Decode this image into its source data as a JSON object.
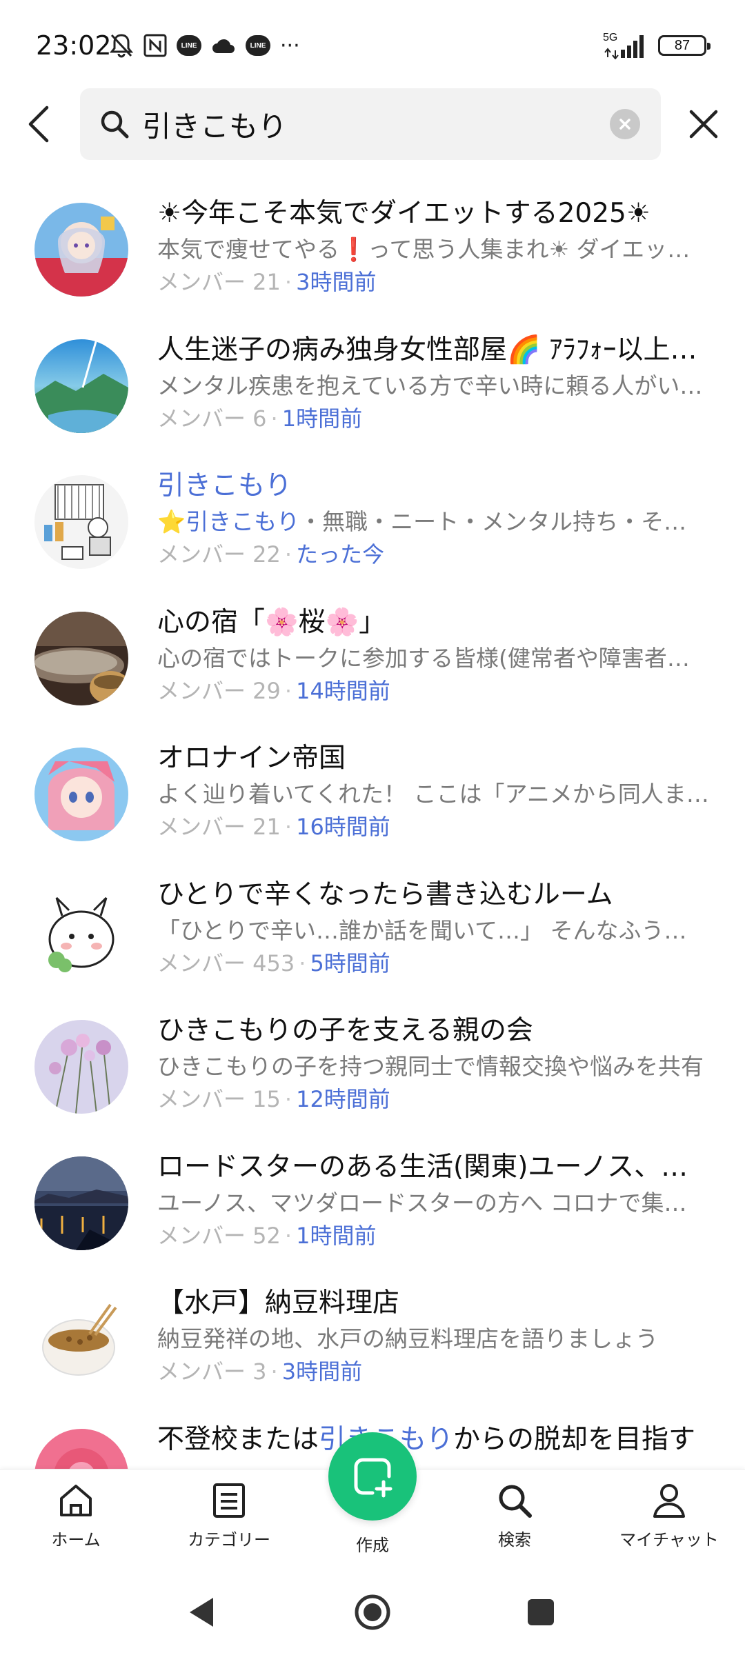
{
  "status_bar": {
    "time": "23:02",
    "network": "5G",
    "battery": "87",
    "line_badge": "LINE",
    "more": "···"
  },
  "search": {
    "query": "引きこもり"
  },
  "results": [
    {
      "title": "☀今年こそ本気でダイエットする2025☀",
      "desc": "本気で痩せてやる❗って思う人集まれ☀ ダイエット仲間募集中",
      "members": "メンバー 21",
      "time": "3時間前"
    },
    {
      "title": "人生迷子の病み独身女性部屋🌈 ｱﾗﾌｫｰ以上の方",
      "desc": "メンタル疾患を抱えている方で辛い時に頼る人がいない方",
      "members": "メンバー 6",
      "time": "1時間前"
    },
    {
      "title": "引きこもり",
      "title_highlight": true,
      "desc_prefix": "⭐",
      "desc_highlight": "引きこもり",
      "desc_rest": "・無職・ニート・メンタル持ち・その他",
      "members": "メンバー 22",
      "time": "たった今"
    },
    {
      "title": "心の宿「🌸桜🌸」",
      "desc": "心の宿ではトークに参加する皆様(健常者や障害者の方々)",
      "members": "メンバー 29",
      "time": "14時間前"
    },
    {
      "title": "オロナイン帝国",
      "desc": "よく辿り着いてくれた！ ここは「アニメから同人まで」",
      "members": "メンバー 21",
      "time": "16時間前"
    },
    {
      "title": "ひとりで辛くなったら書き込むルーム",
      "desc": "「ひとりで辛い…誰か話を聞いて…」 そんなふうに思ったら",
      "members": "メンバー 453",
      "time": "5時間前"
    },
    {
      "title": "ひきこもりの子を支える親の会",
      "desc": "ひきこもりの子を持つ親同士で情報交換や悩みを共有",
      "members": "メンバー 15",
      "time": "12時間前"
    },
    {
      "title": "ロードスターのある生活(関東)ユーノス、マツダ",
      "desc": "ユーノス、マツダロードスターの方へ コロナで集まれない",
      "members": "メンバー 52",
      "time": "1時間前"
    },
    {
      "title": "【水戸】納豆料理店",
      "desc": "納豆発祥の地、水戸の納豆料理店を語りましょう",
      "members": "メンバー 3",
      "time": "3時間前"
    },
    {
      "title_prefix": "不登校または",
      "title_highlight_part": "引きこもり",
      "title_rest": "からの脱却を目指す",
      "desc": "",
      "members": "",
      "time": ""
    }
  ],
  "bottom_nav": {
    "home": "ホーム",
    "category": "カテゴリー",
    "create": "作成",
    "search": "検索",
    "mychat": "マイチャット"
  },
  "colors": {
    "accent_blue": "#4b6fd6",
    "fab_green": "#19c27a",
    "meta_gray": "#b4b4b4"
  }
}
